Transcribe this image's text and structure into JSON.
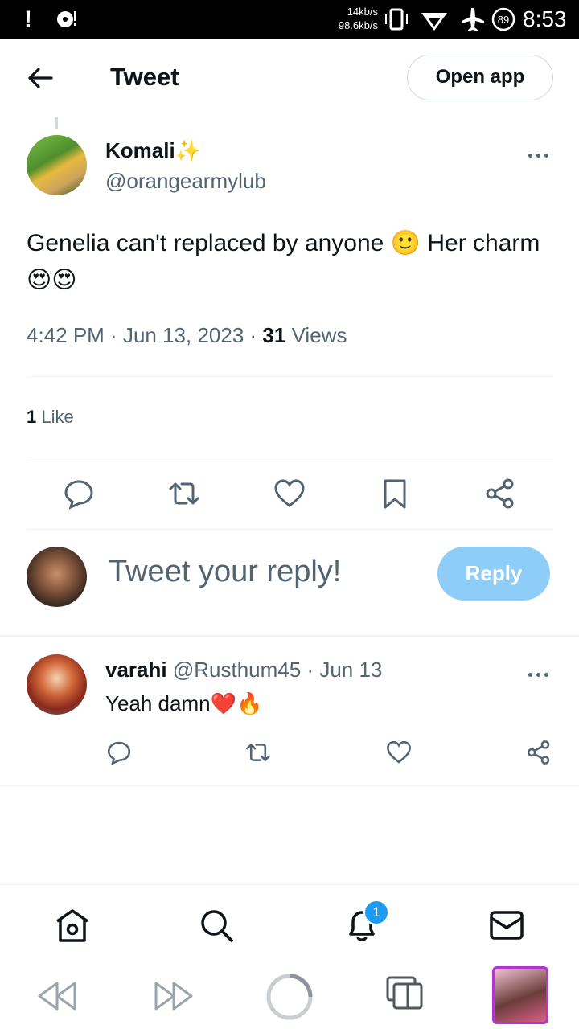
{
  "status_bar": {
    "left_alert": "!",
    "speed_up": "14kb/s",
    "speed_down": "98.6kb/s",
    "battery": "89",
    "time": "8:53"
  },
  "header": {
    "title": "Tweet",
    "open_app": "Open app"
  },
  "tweet": {
    "author_name": "Komali",
    "author_emoji": "✨",
    "author_handle": "@orangearmylub",
    "text": "Genelia can't replaced by anyone 🙂 Her charm 😍😍",
    "time": "4:42 PM",
    "date": "Jun 13, 2023",
    "views_count": "31",
    "views_label": "Views",
    "likes_count": "1",
    "likes_label": "Like"
  },
  "composer": {
    "placeholder": "Tweet your reply!",
    "reply_button": "Reply"
  },
  "replies": [
    {
      "name": "varahi",
      "handle": "@Rusthum45",
      "date": "Jun 13",
      "text": "Yeah damn❤️🔥"
    }
  ],
  "bottom_nav": {
    "notification_badge": "1"
  },
  "colors": {
    "accent": "#1d9bf0",
    "reply_button_disabled": "#8ecdf8",
    "secondary_text": "#536471",
    "thumbnail_border": "#b532d6"
  }
}
